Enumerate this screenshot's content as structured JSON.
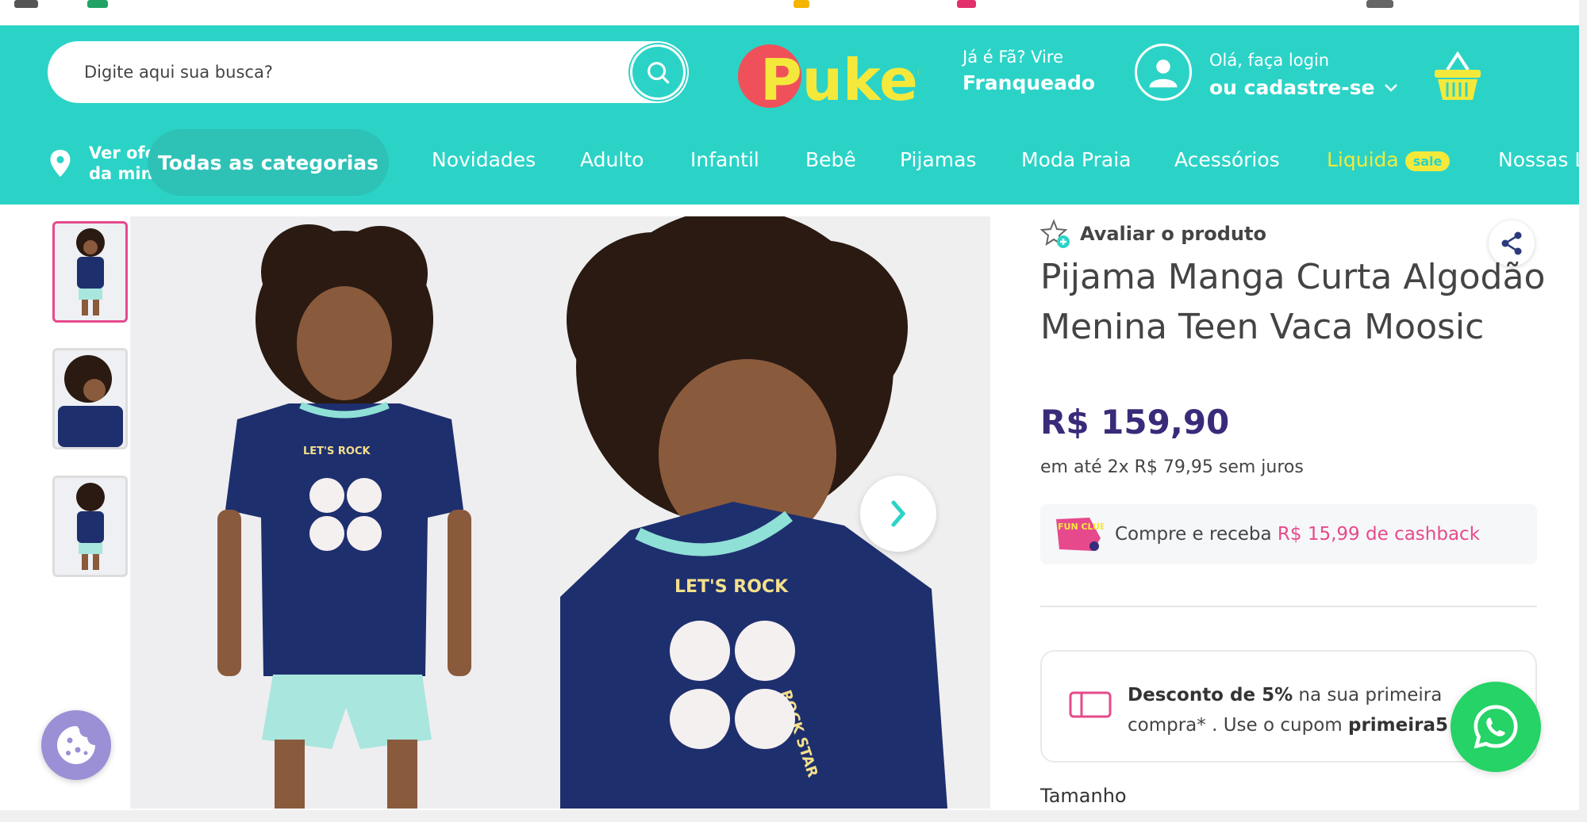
{
  "header": {
    "search_placeholder": "Digite aqui sua busca?",
    "logo_text": "Puket",
    "franchise_line1": "Já é Fã? Vire",
    "franchise_line2": "Franqueado",
    "login_line1": "Olá, faça login",
    "login_line2": "ou cadastre-se"
  },
  "nav": {
    "location_line1": "Ver ofertas",
    "location_line2": "da minha cidade",
    "all_categories": "Todas as categorias",
    "items": [
      "Novidades",
      "Adulto",
      "Infantil",
      "Bebê",
      "Pijamas",
      "Moda Praia",
      "Acessórios",
      "Liquida",
      "Nossas L"
    ],
    "sale_badge": "sale"
  },
  "product": {
    "rate_label": "Avaliar o produto",
    "title": "Pijama Manga Curta Algodão Menina Teen Vaca Moosic",
    "price": "R$ 159,90",
    "installments": "em até 2x R$ 79,95 sem juros",
    "cashback_prefix": "Compre e receba ",
    "cashback_highlight": "R$ 15,99 de cashback",
    "cashback_logo_text": "FUN CLUBE",
    "discount_bold": "Desconto de 5%",
    "discount_mid": " na sua primeira compra* . Use o cupom ",
    "discount_code": "primeira5",
    "size_label": "Tamanho",
    "shirt_print_top": "LET'S ROCK",
    "shirt_print_side": "ROCK STAR"
  },
  "colors": {
    "brand_teal": "#2bd3c7",
    "price_purple": "#3a2a7a",
    "accent_pink": "#e64a8c",
    "liquida_yellow": "#f4e93b",
    "whatsapp_green": "#25d366"
  }
}
